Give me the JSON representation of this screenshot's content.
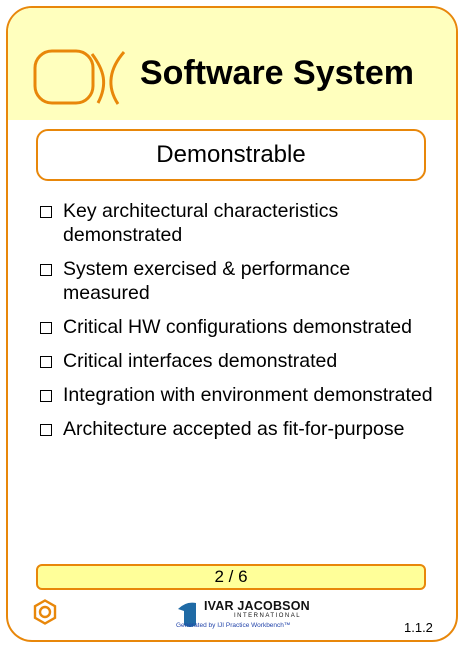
{
  "card": {
    "title": "Software System",
    "state": "Demonstrable",
    "checklist": [
      "Key architectural characteristics demonstrated",
      "System exercised & performance measured",
      "Critical HW configurations demonstrated",
      "Critical interfaces demonstrated",
      "Integration with environment demonstrated",
      "Architecture accepted as fit-for-purpose"
    ],
    "progress": "2 / 6",
    "version": "1.1.2",
    "icon": "alpha-icon"
  },
  "logo": {
    "name": "IVAR JACOBSON",
    "subtitle": "INTERNATIONAL",
    "credit": "Generated by IJI Practice Workbench™"
  },
  "colors": {
    "accent": "#E8870A",
    "header_bg": "#FFFFBE",
    "footer_bg": "#FFFF99",
    "logo_blue": "#1f6aa5"
  }
}
